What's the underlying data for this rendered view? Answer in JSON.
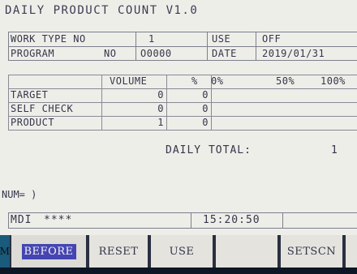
{
  "title": "DAILY PRODUCT COUNT V1.0",
  "info": {
    "work_type_label": "WORK TYPE NO",
    "work_type_value": "1",
    "use_label": "USE",
    "use_value": "OFF",
    "program_label": "PROGRAM",
    "program_no_label": "NO",
    "program_value": "O0000",
    "date_label": "DATE",
    "date_value": "2019/01/31"
  },
  "table": {
    "headers": {
      "volume": "VOLUME",
      "percent": "%",
      "scale0": "0%",
      "scale50": "50%",
      "scale100": "100%"
    },
    "rows": [
      {
        "label": "TARGET",
        "volume": "0",
        "percent": "0",
        "progress": 0
      },
      {
        "label": "SELF CHECK",
        "volume": "0",
        "percent": "0",
        "progress": 0
      },
      {
        "label": "PRODUCT",
        "volume": "1",
        "percent": "0",
        "progress": 0
      }
    ]
  },
  "daily_total": {
    "label": "DAILY TOTAL:",
    "value": "1"
  },
  "input_line": "NUM= )",
  "status": {
    "mode": "MDI",
    "alarm": "****",
    "time": "15:20:50"
  },
  "softkeys": {
    "left_edge": "M",
    "before": "BEFORE",
    "reset": "RESET",
    "use": "USE",
    "blank": "",
    "setscn": "SETSCN"
  },
  "colors": {
    "screen_bg": "#eeeee9",
    "text": "#34364a",
    "highlight_bg": "#4545b2",
    "highlight_text": "#f2f2f4",
    "bezel": "#0c1624"
  }
}
